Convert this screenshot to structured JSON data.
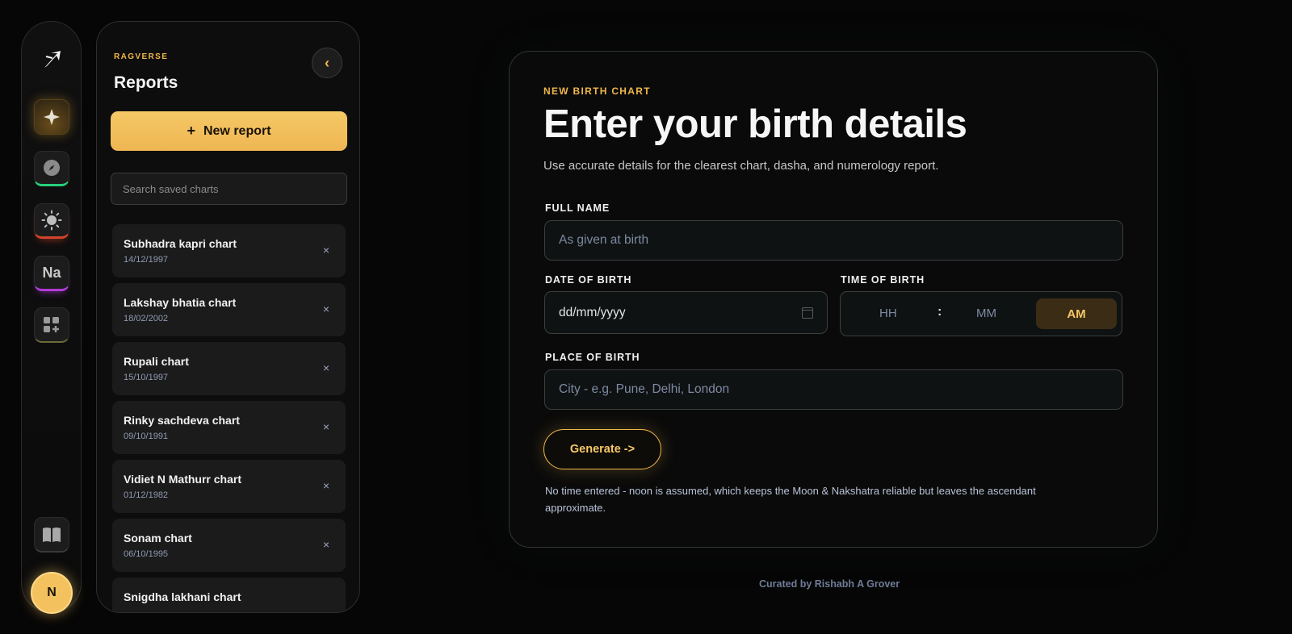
{
  "rail": {
    "items": [
      {
        "name": "sparkle",
        "label": ""
      },
      {
        "name": "compass",
        "label": ""
      },
      {
        "name": "sun",
        "label": ""
      },
      {
        "name": "numerology",
        "label": "Na"
      },
      {
        "name": "apps",
        "label": ""
      },
      {
        "name": "book",
        "label": ""
      }
    ],
    "avatar_initial": "N"
  },
  "sidebar": {
    "brand": "RAGVERSE",
    "title": "Reports",
    "collapse_icon": "‹",
    "new_report": {
      "icon": "+",
      "label": "New report"
    },
    "search_placeholder": "Search saved charts",
    "reports": [
      {
        "name": "Subhadra kapri chart",
        "date": "14/12/1997"
      },
      {
        "name": "Lakshay bhatia chart",
        "date": "18/02/2002"
      },
      {
        "name": "Rupali chart",
        "date": "15/10/1997"
      },
      {
        "name": "Rinky sachdeva chart",
        "date": "09/10/1991"
      },
      {
        "name": "Vidiet N Mathurr chart",
        "date": "01/12/1982"
      },
      {
        "name": "Sonam chart",
        "date": "06/10/1995"
      },
      {
        "name": "Snigdha lakhani chart",
        "date": ""
      }
    ],
    "delete_icon": "×"
  },
  "form": {
    "eyebrow": "NEW BIRTH CHART",
    "headline": "Enter your birth details",
    "subline": "Use accurate details for the clearest chart, dasha, and numerology report.",
    "full_name": {
      "label": "FULL NAME",
      "placeholder": "As given at birth"
    },
    "dob": {
      "label": "DATE OF BIRTH",
      "value": "dd/mm/yyyy"
    },
    "time": {
      "label": "TIME OF BIRTH",
      "hh": "HH",
      "separator": ":",
      "mm": "MM",
      "period": "AM"
    },
    "place": {
      "label": "PLACE OF BIRTH",
      "placeholder": "City - e.g. Pune, Delhi, London"
    },
    "generate_label": "Generate ->",
    "note": "No time entered - noon is assumed, which keeps the Moon & Nakshatra reliable but leaves the ascendant approximate."
  },
  "footer": "Curated by Rishabh A Grover",
  "colors": {
    "accent": "#f0b74a",
    "background": "#060606",
    "card": "#0a0a0a"
  }
}
